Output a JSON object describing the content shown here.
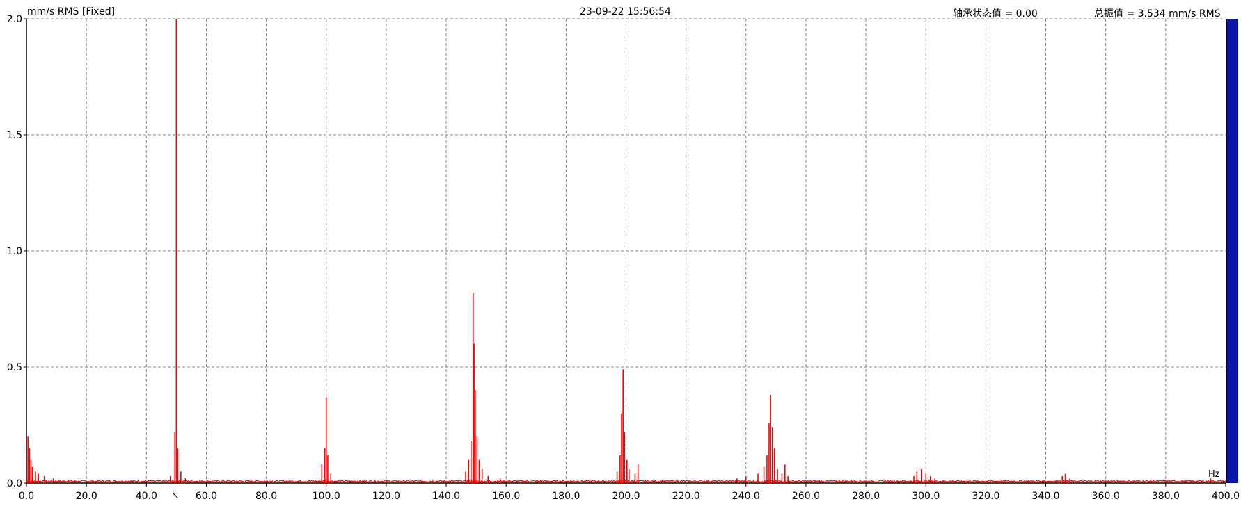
{
  "header": {
    "units_label": "mm/s  RMS  [Fixed]",
    "timestamp": "23-09-22  15:56:54",
    "bearing_label": "轴承状态值 = 0.00",
    "overall_label": "总振值 = 3.534 mm/s RMS"
  },
  "colors": {
    "trace": "#ff0000",
    "grid": "#808080",
    "side_bar": "#0a14a8"
  },
  "chart_data": {
    "type": "line",
    "xlabel": "Hz",
    "ylabel": "",
    "xlim": [
      0,
      400
    ],
    "ylim": [
      0,
      2.0
    ],
    "x_ticks": [
      "0.0",
      "20.0",
      "40.0",
      "60.0",
      "80.0",
      "100.0",
      "120.0",
      "140.0",
      "160.0",
      "180.0",
      "200.0",
      "220.0",
      "240.0",
      "260.0",
      "280.0",
      "300.0",
      "320.0",
      "340.0",
      "360.0",
      "380.0",
      "400.0"
    ],
    "y_ticks": [
      "0.0",
      "0.5",
      "1.0",
      "1.5",
      "2.0"
    ],
    "grid": true,
    "series": [
      {
        "peaks": [
          {
            "x": 0.5,
            "y": 0.2
          },
          {
            "x": 1.0,
            "y": 0.15
          },
          {
            "x": 1.5,
            "y": 0.1
          },
          {
            "x": 2.0,
            "y": 0.07
          },
          {
            "x": 3.0,
            "y": 0.05
          },
          {
            "x": 4.0,
            "y": 0.04
          },
          {
            "x": 6.0,
            "y": 0.03
          },
          {
            "x": 9.0,
            "y": 0.02
          },
          {
            "x": 14.0,
            "y": 0.015
          },
          {
            "x": 48.0,
            "y": 0.03
          },
          {
            "x": 49.5,
            "y": 0.22
          },
          {
            "x": 50.0,
            "y": 2.0
          },
          {
            "x": 50.5,
            "y": 0.15
          },
          {
            "x": 51.5,
            "y": 0.05
          },
          {
            "x": 53.0,
            "y": 0.02
          },
          {
            "x": 98.5,
            "y": 0.08
          },
          {
            "x": 99.5,
            "y": 0.15
          },
          {
            "x": 100.0,
            "y": 0.37
          },
          {
            "x": 100.5,
            "y": 0.12
          },
          {
            "x": 101.5,
            "y": 0.04
          },
          {
            "x": 146.5,
            "y": 0.05
          },
          {
            "x": 147.5,
            "y": 0.1
          },
          {
            "x": 148.3,
            "y": 0.18
          },
          {
            "x": 149.0,
            "y": 0.82
          },
          {
            "x": 149.3,
            "y": 0.6
          },
          {
            "x": 149.7,
            "y": 0.4
          },
          {
            "x": 150.3,
            "y": 0.2
          },
          {
            "x": 151.0,
            "y": 0.1
          },
          {
            "x": 152.0,
            "y": 0.06
          },
          {
            "x": 154.0,
            "y": 0.03
          },
          {
            "x": 158.0,
            "y": 0.02
          },
          {
            "x": 197.0,
            "y": 0.05
          },
          {
            "x": 198.0,
            "y": 0.12
          },
          {
            "x": 198.5,
            "y": 0.3
          },
          {
            "x": 199.0,
            "y": 0.49
          },
          {
            "x": 199.5,
            "y": 0.22
          },
          {
            "x": 200.3,
            "y": 0.1
          },
          {
            "x": 201.0,
            "y": 0.06
          },
          {
            "x": 203.0,
            "y": 0.04
          },
          {
            "x": 204.0,
            "y": 0.08
          },
          {
            "x": 237.0,
            "y": 0.02
          },
          {
            "x": 240.0,
            "y": 0.03
          },
          {
            "x": 244.0,
            "y": 0.04
          },
          {
            "x": 246.0,
            "y": 0.07
          },
          {
            "x": 247.0,
            "y": 0.12
          },
          {
            "x": 247.7,
            "y": 0.26
          },
          {
            "x": 248.2,
            "y": 0.38
          },
          {
            "x": 248.8,
            "y": 0.24
          },
          {
            "x": 249.5,
            "y": 0.15
          },
          {
            "x": 250.5,
            "y": 0.06
          },
          {
            "x": 252.0,
            "y": 0.04
          },
          {
            "x": 253.0,
            "y": 0.08
          },
          {
            "x": 254.0,
            "y": 0.03
          },
          {
            "x": 296.0,
            "y": 0.03
          },
          {
            "x": 297.0,
            "y": 0.05
          },
          {
            "x": 298.5,
            "y": 0.06
          },
          {
            "x": 300.0,
            "y": 0.04
          },
          {
            "x": 301.5,
            "y": 0.03
          },
          {
            "x": 303.0,
            "y": 0.02
          },
          {
            "x": 345.5,
            "y": 0.03
          },
          {
            "x": 346.5,
            "y": 0.04
          },
          {
            "x": 348.0,
            "y": 0.02
          },
          {
            "x": 392.0,
            "y": 0.01
          },
          {
            "x": 395.0,
            "y": 0.02
          }
        ]
      }
    ]
  }
}
